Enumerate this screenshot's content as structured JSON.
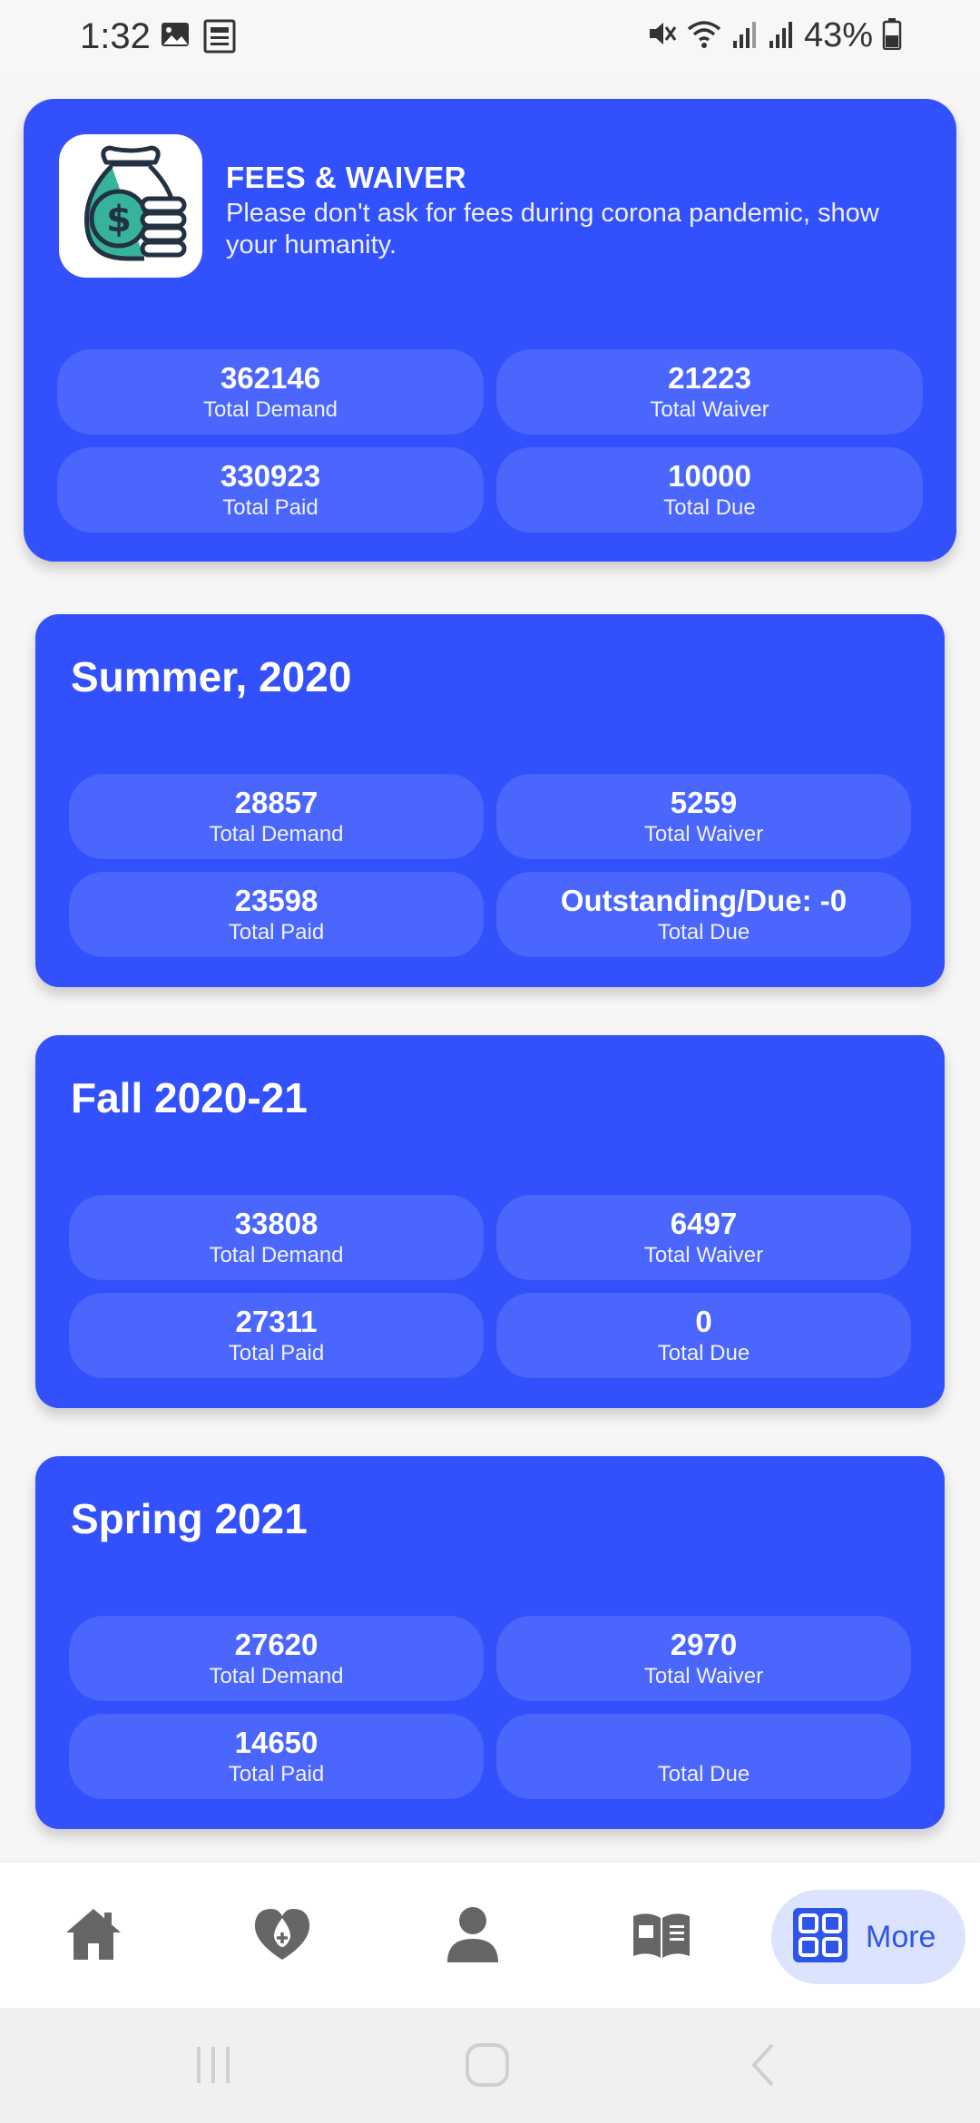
{
  "status_bar": {
    "time": "1:32",
    "battery": "43%"
  },
  "summary": {
    "title": "FEES & WAIVER",
    "subtitle": "Please don't ask for fees during corona pandemic, show your humanity.",
    "stats": [
      {
        "value": "362146",
        "label": "Total Demand"
      },
      {
        "value": "21223",
        "label": "Total Waiver"
      },
      {
        "value": "330923",
        "label": "Total Paid"
      },
      {
        "value": "10000",
        "label": "Total Due"
      }
    ]
  },
  "terms": [
    {
      "title": "Summer, 2020",
      "stats": [
        {
          "value": "28857",
          "label": "Total Demand"
        },
        {
          "value": "5259",
          "label": "Total Waiver"
        },
        {
          "value": "23598",
          "label": "Total Paid"
        },
        {
          "value": "Outstanding/Due: -0",
          "label": "Total Due"
        }
      ]
    },
    {
      "title": "Fall 2020-21",
      "stats": [
        {
          "value": "33808",
          "label": "Total Demand"
        },
        {
          "value": "6497",
          "label": "Total Waiver"
        },
        {
          "value": "27311",
          "label": "Total Paid"
        },
        {
          "value": "0",
          "label": "Total Due"
        }
      ]
    },
    {
      "title": "Spring 2021",
      "stats": [
        {
          "value": "27620",
          "label": "Total Demand"
        },
        {
          "value": "2970",
          "label": "Total Waiver"
        },
        {
          "value": "14650",
          "label": "Total Paid"
        },
        {
          "value": "",
          "label": "Total Due"
        }
      ]
    }
  ],
  "bottom_nav": {
    "items": [
      {
        "icon": "home-icon"
      },
      {
        "icon": "donation-icon"
      },
      {
        "icon": "profile-icon"
      },
      {
        "icon": "book-icon"
      }
    ],
    "more": {
      "icon": "grid-icon",
      "label": "More"
    }
  },
  "colors": {
    "card_background": "#3250fc",
    "pill_background": "#4a66fd",
    "more_highlight": "#dbe3ff",
    "more_text": "#2f55e8"
  }
}
